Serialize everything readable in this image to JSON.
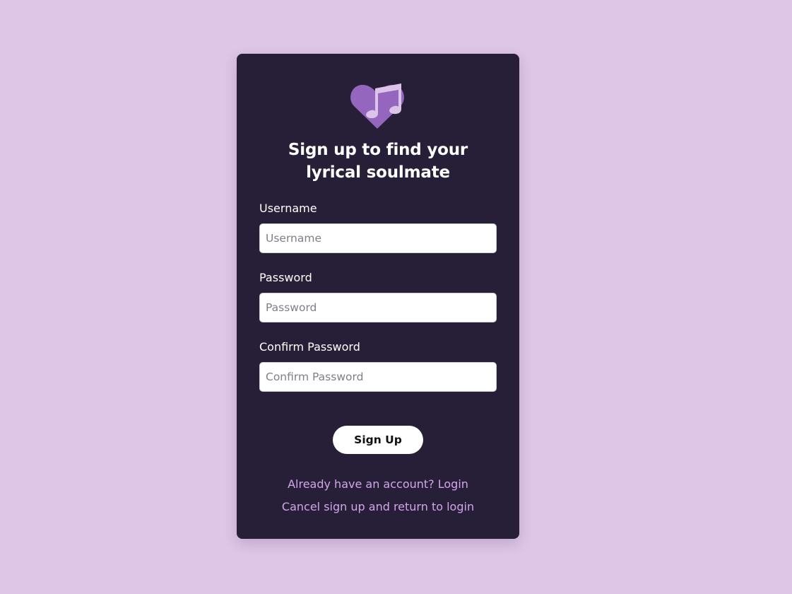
{
  "page": {
    "background_color": "#ddc6e6",
    "card_color": "#271e37",
    "accent_color": "#9b6cc4",
    "link_color": "#d2a7ea"
  },
  "logo": {
    "icon": "heart-music-note-icon"
  },
  "heading": {
    "title": "Sign up to find your lyrical soulmate"
  },
  "form": {
    "username": {
      "label": "Username",
      "placeholder": "Username",
      "value": ""
    },
    "password": {
      "label": "Password",
      "placeholder": "Password",
      "value": ""
    },
    "confirm_password": {
      "label": "Confirm Password",
      "placeholder": "Confirm Password",
      "value": ""
    },
    "submit_label": "Sign Up"
  },
  "links": {
    "login": "Already have an account? Login",
    "cancel": "Cancel sign up and return to login"
  }
}
